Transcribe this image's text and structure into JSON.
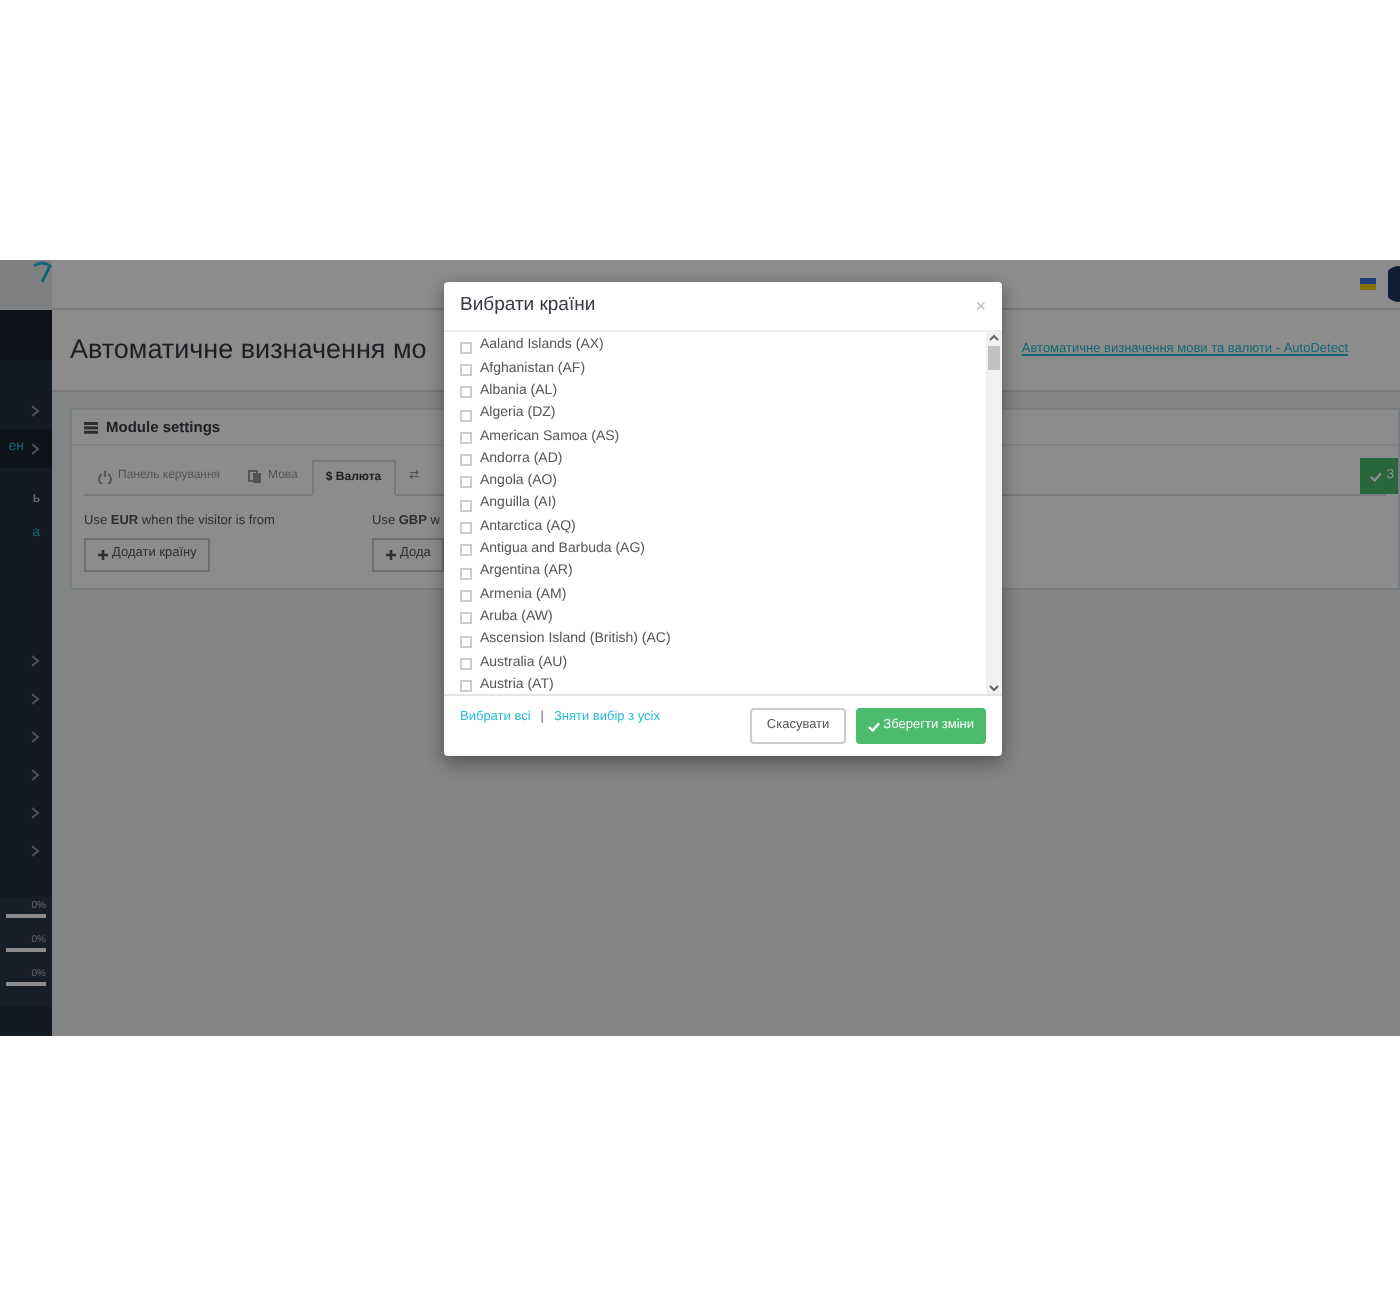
{
  "sidebar": {
    "active_label": "ен",
    "fragments": [
      "ь",
      "а"
    ],
    "progress": [
      {
        "label": "0%",
        "level": 0
      },
      {
        "label": "0%",
        "level": 0
      },
      {
        "label": "0%",
        "level": 0
      }
    ]
  },
  "page_title": "Автоматичне визначення мо",
  "breadcrumb": "Автоматичне визначення мови та валюти - AutoDetect",
  "card": {
    "title": "Module settings",
    "tabs": [
      {
        "label": "Панель керування",
        "selected": false
      },
      {
        "label": "Мова",
        "selected": false
      },
      {
        "label": "Валюта",
        "symbol": "$",
        "selected": true
      },
      {
        "symbol": "⇄",
        "selected": false
      }
    ],
    "rules": [
      {
        "text": "Use **EUR** when the visitor is from",
        "button": "Додати країну"
      },
      {
        "text": "Use **GBP** w",
        "button": "Дода"
      }
    ],
    "save_button": "З"
  },
  "modal": {
    "title": "Вибрати країни",
    "close": "×",
    "countries": [
      {
        "label": "Aaland Islands (AX)",
        "checked": false
      },
      {
        "label": "Afghanistan (AF)",
        "checked": false
      },
      {
        "label": "Albania (AL)",
        "checked": false
      },
      {
        "label": "Algeria (DZ)",
        "checked": false
      },
      {
        "label": "American Samoa (AS)",
        "checked": false
      },
      {
        "label": "Andorra (AD)",
        "checked": false
      },
      {
        "label": "Angola (AO)",
        "checked": false
      },
      {
        "label": "Anguilla (AI)",
        "checked": false
      },
      {
        "label": "Antarctica (AQ)",
        "checked": false
      },
      {
        "label": "Antigua and Barbuda (AG)",
        "checked": false
      },
      {
        "label": "Argentina (AR)",
        "checked": false
      },
      {
        "label": "Armenia (AM)",
        "checked": false
      },
      {
        "label": "Aruba (AW)",
        "checked": false
      },
      {
        "label": "Ascension Island (British) (AC)",
        "checked": false
      },
      {
        "label": "Australia (AU)",
        "checked": false
      },
      {
        "label": "Austria (AT)",
        "checked": false
      }
    ],
    "select_all": "Вибрати всі",
    "separator": "|",
    "deselect_all": "Зняти вибір з усіх",
    "cancel": "Скасувати",
    "save": "Зберегти зміни"
  }
}
